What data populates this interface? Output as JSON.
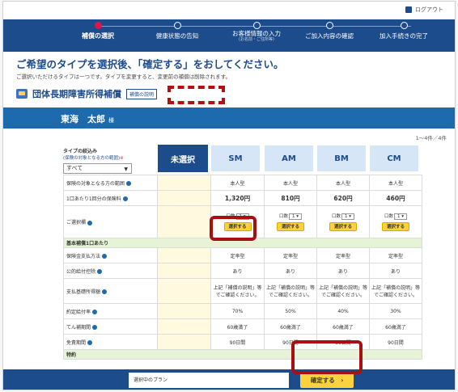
{
  "header": {
    "logout_label": "ログアウト"
  },
  "steps": [
    {
      "label": "補償の選択",
      "sub": "",
      "active": true
    },
    {
      "label": "健康状態の告知",
      "sub": ""
    },
    {
      "label": "お客様情報の入力",
      "sub": "(お名前・ご住所等)"
    },
    {
      "label": "ご加入内容の確認",
      "sub": ""
    },
    {
      "label": "加入手続きの完了",
      "sub": ""
    }
  ],
  "page": {
    "title": "ご希望のタイプを選択後、「確定する」をおしてください。",
    "lead": "ご選択いただけるタイプは一つです。タイプを変更すると、変更前の補償は削除されます。",
    "product_name": "団体長期障害所得補償",
    "explain_label": "補償の説明",
    "insured_name": "東海　太郎",
    "honorific": "様",
    "count": "1〜4件／4件"
  },
  "filter": {
    "title": "タイプの絞込み",
    "note": "(保険の対象となる方の範囲)",
    "required_mark": "※",
    "value": "すべて"
  },
  "columns": {
    "none": "未選択",
    "plans": [
      "SM",
      "AM",
      "BM",
      "CM"
    ]
  },
  "rows": {
    "scope": {
      "label": "保険の対象となる方の範囲",
      "values": [
        "本人型",
        "本人型",
        "本人型",
        "本人型"
      ]
    },
    "premium": {
      "label": "1口あたり1回分の保険料",
      "values": [
        "1,320円",
        "810円",
        "620円",
        "460円"
      ]
    },
    "units": {
      "label": "ご選択欄",
      "unit_label": "口数",
      "unit_value": "1",
      "button": "選択する"
    },
    "section1": "基本補償1口あたり",
    "pay_method": {
      "label": "保険金支払方法",
      "values": [
        "定率型",
        "定率型",
        "定率型",
        "定率型"
      ]
    },
    "public_deduct": {
      "label": "公的給付控除",
      "values": [
        "あり",
        "あり",
        "あり",
        "あり"
      ]
    },
    "base_income": {
      "label": "支払基礎所得額",
      "values": [
        "上記「補償の説明」等でご確認ください。",
        "上記「補償の説明」等でご確認ください。",
        "上記「補償の説明」等でご確認ください。",
        "上記「補償の説明」等でご確認ください。"
      ]
    },
    "rate": {
      "label": "約定給付率",
      "values": [
        "70%",
        "50%",
        "40%",
        "30%"
      ]
    },
    "period": {
      "label": "てん補期間",
      "values": [
        "60歳満了",
        "60歳満了",
        "60歳満了",
        "60歳満了"
      ]
    },
    "exempt": {
      "label": "免責期間",
      "values": [
        "90日間",
        "90日間",
        "90日間",
        "90日間"
      ]
    },
    "section2": "特約"
  },
  "footer": {
    "selected_label": "選択中のプラン",
    "confirm_label": "確定する　›"
  },
  "colors": {
    "navy": "#1d4c8c",
    "blue": "#1d6aaf",
    "yellow": "#fbd23d",
    "highlight": "#a80f12"
  }
}
